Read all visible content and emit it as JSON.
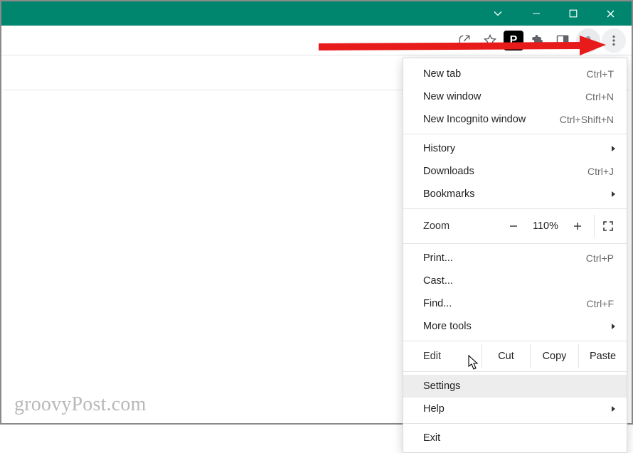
{
  "menu": {
    "new_tab": {
      "label": "New tab",
      "shortcut": "Ctrl+T"
    },
    "new_window": {
      "label": "New window",
      "shortcut": "Ctrl+N"
    },
    "new_incognito": {
      "label": "New Incognito window",
      "shortcut": "Ctrl+Shift+N"
    },
    "history": {
      "label": "History"
    },
    "downloads": {
      "label": "Downloads",
      "shortcut": "Ctrl+J"
    },
    "bookmarks": {
      "label": "Bookmarks"
    },
    "zoom": {
      "label": "Zoom",
      "value": "110%"
    },
    "print": {
      "label": "Print...",
      "shortcut": "Ctrl+P"
    },
    "cast": {
      "label": "Cast..."
    },
    "find": {
      "label": "Find...",
      "shortcut": "Ctrl+F"
    },
    "more_tools": {
      "label": "More tools"
    },
    "edit": {
      "label": "Edit",
      "cut": "Cut",
      "copy": "Copy",
      "paste": "Paste"
    },
    "settings": {
      "label": "Settings"
    },
    "help": {
      "label": "Help"
    },
    "exit": {
      "label": "Exit"
    }
  },
  "toolbar": {
    "ext_p_label": "P"
  },
  "watermark": "groovyPost.com"
}
